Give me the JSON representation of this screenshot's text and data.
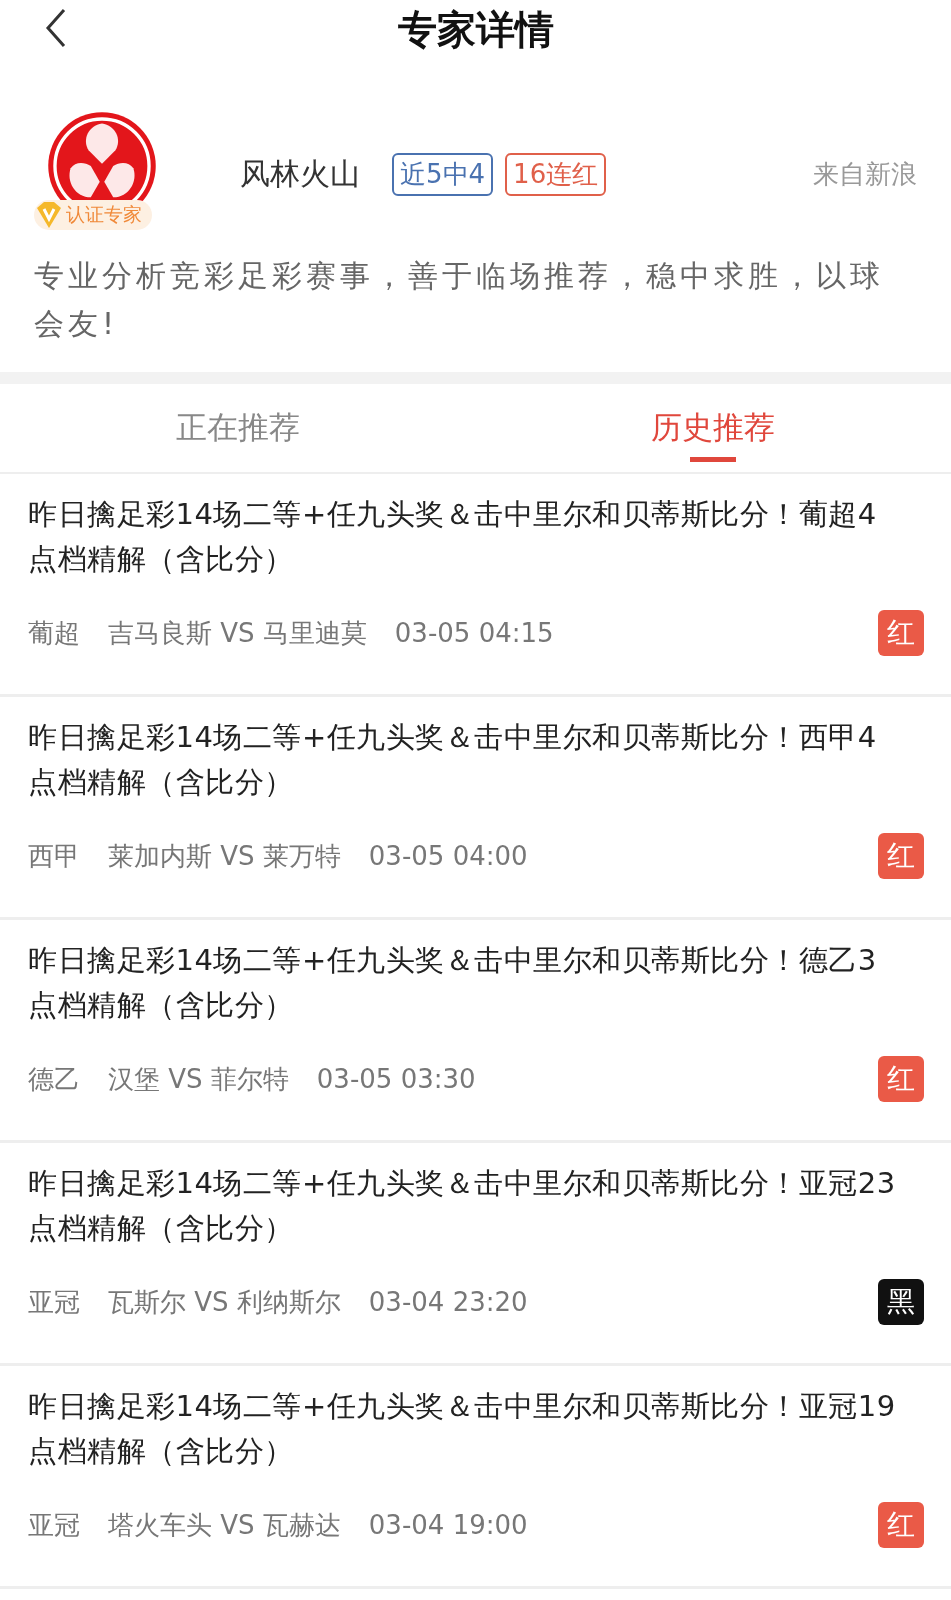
{
  "nav": {
    "title": "专家详情"
  },
  "expert": {
    "name": "风林火山",
    "verified_label": "认证专家",
    "badges": [
      {
        "text": "近5中4",
        "color": "#4a72b0"
      },
      {
        "text": "16连红",
        "color": "#e0604a"
      }
    ],
    "source": "来自新浪",
    "bio": "专业分析竞彩足彩赛事，善于临场推荐，稳中求胜，以球会友!"
  },
  "tabs": [
    {
      "label": "正在推荐",
      "selected": false
    },
    {
      "label": "历史推荐",
      "selected": true
    }
  ],
  "recommendations": [
    {
      "title": "昨日擒足彩14场二等+任九头奖＆击中里尔和贝蒂斯比分！葡超4点档精解（含比分）",
      "league": "葡超",
      "match": "吉马良斯 VS 马里迪莫",
      "time": "03-05 04:15",
      "result": "红",
      "color": "#ea5a47"
    },
    {
      "title": "昨日擒足彩14场二等+任九头奖＆击中里尔和贝蒂斯比分！西甲4点档精解（含比分）",
      "league": "西甲",
      "match": "莱加内斯 VS 莱万特",
      "time": "03-05 04:00",
      "result": "红",
      "color": "#ea5a47"
    },
    {
      "title": "昨日擒足彩14场二等+任九头奖＆击中里尔和贝蒂斯比分！德乙3点档精解（含比分）",
      "league": "德乙",
      "match": "汉堡 VS 菲尔特",
      "time": "03-05 03:30",
      "result": "红",
      "color": "#ea5a47"
    },
    {
      "title": "昨日擒足彩14场二等+任九头奖＆击中里尔和贝蒂斯比分！亚冠23点档精解（含比分）",
      "league": "亚冠",
      "match": "瓦斯尔 VS 利纳斯尔",
      "time": "03-04 23:20",
      "result": "黑",
      "color": "#111111"
    },
    {
      "title": "昨日擒足彩14场二等+任九头奖＆击中里尔和贝蒂斯比分！亚冠19点档精解（含比分）",
      "league": "亚冠",
      "match": "塔火车头 VS 瓦赫达",
      "time": "03-04 19:00",
      "result": "红",
      "color": "#ea5a47"
    }
  ]
}
